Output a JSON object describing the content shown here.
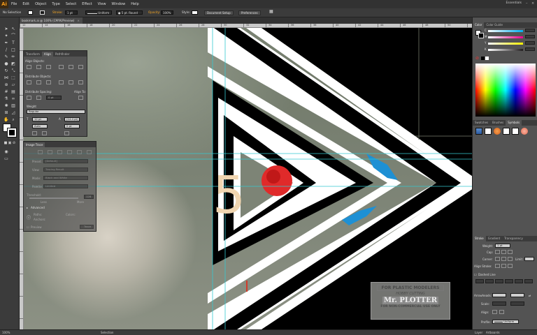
{
  "app": {
    "logo": "Ai",
    "menu": [
      "File",
      "Edit",
      "Object",
      "Type",
      "Select",
      "Effect",
      "View",
      "Window",
      "Help"
    ],
    "workspace": "Essentials"
  },
  "control_bar": {
    "selection_label": "No Selection",
    "stroke_label": "Stroke:",
    "stroke_weight": "1 pt",
    "uniform": "Uniform",
    "brush": "5 pt. Round",
    "opacity_label": "Opacity:",
    "opacity_value": "100%",
    "style_label": "Style:",
    "document_setup": "Document Setup",
    "preferences": "Preferences"
  },
  "document": {
    "tab_title": "bookmark.ai @ 100% (CMYK/Preview)",
    "close": "×",
    "ruler_labels": [
      "12",
      "14",
      "16",
      "18",
      "20",
      "22",
      "24",
      "26",
      "28",
      "30",
      "32",
      "34",
      "36",
      "38",
      "40",
      "42",
      "44",
      "46",
      "48",
      "50"
    ]
  },
  "canvas": {
    "digit": "5",
    "watermark": {
      "line1": "FOR PLASTIC MODELERS",
      "line2": "HOBBY CUTTING",
      "line3": "Mr. PLOTTER",
      "line4": "FOR NON-COMMERCIAL USE ONLY"
    }
  },
  "align_panel": {
    "tabs": [
      "Transform",
      "Align",
      "Pathfinder"
    ],
    "align_objects": "Align Objects:",
    "distribute_objects": "Distribute Objects:",
    "distribute_spacing": "Distribute Spacing:",
    "align_to": "Align To:",
    "stroke_subpanel": "Weight",
    "stroke_value": "Regular",
    "size_value": "12 pt",
    "leading_value": "(14.4 pt)",
    "auto": "Auto",
    "offset": "0 pt"
  },
  "image_trace": {
    "title": "Image Trace",
    "rows": [
      {
        "label": "Preset:",
        "value": "[Default]"
      },
      {
        "label": "View:",
        "value": "Tracing Result"
      },
      {
        "label": "Mode:",
        "value": "Black and White"
      },
      {
        "label": "Palette:",
        "value": "Limited"
      }
    ],
    "threshold": "Threshold:",
    "threshold_value": "128",
    "less": "Less",
    "more": "More",
    "advanced": "Advanced",
    "paths": "Paths:",
    "colors": "Colors:",
    "anchors": "Anchors:",
    "preview": "Preview",
    "trace": "Trace"
  },
  "color_panel": {
    "tabs": [
      "Color",
      "Color Guide"
    ],
    "channels": [
      {
        "label": "C",
        "color": "#00aeef"
      },
      {
        "label": "M",
        "color": "#ec008c"
      },
      {
        "label": "Y",
        "color": "#fff200"
      },
      {
        "label": "K",
        "color": "#231f20"
      }
    ]
  },
  "swatch_panel": {
    "tabs": [
      "Swatches",
      "Brushes",
      "Symbols"
    ]
  },
  "stroke_panel": {
    "tabs": [
      "Stroke",
      "Gradient",
      "Transparency"
    ],
    "weight_label": "Weight:",
    "weight_value": "1 pt",
    "cap_label": "Cap:",
    "corner_label": "Corner:",
    "limit_label": "Limit:",
    "align_stroke": "Align Stroke:",
    "dashed_line": "Dashed Line",
    "arrowheads": "Arrowheads:",
    "scale_label": "Scale:",
    "align_label": "Align:",
    "profile_label": "Profile:",
    "profile_value": "Uniform"
  },
  "bottom_dock": {
    "tabs": [
      "Layer",
      "Artboards"
    ]
  },
  "status": {
    "zoom": "100%",
    "tool": "Selection"
  }
}
